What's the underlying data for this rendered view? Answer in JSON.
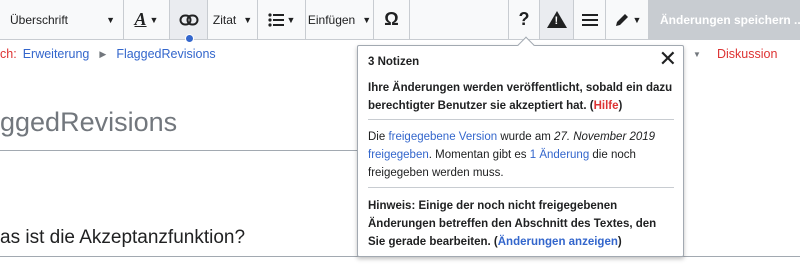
{
  "toolbar": {
    "format_label": "Überschrift",
    "quote_label": "Zitat",
    "insert_label": "Einfügen",
    "omega_glyph": "Ω",
    "help_glyph": "?",
    "warning_glyph": "!",
    "save_label": "Änderungen speichern ..."
  },
  "breadcrumb": {
    "prefix": "ch:",
    "items": [
      "Erweiterung",
      "FlaggedRevisions"
    ]
  },
  "page": {
    "title": "ggedRevisions",
    "section_heading": "as ist die Akzeptanzfunktion?"
  },
  "tabs": {
    "discussion": "Diskussion"
  },
  "popup": {
    "title": "3 Notizen",
    "close_glyph": "✕",
    "notice1": {
      "text": "Ihre Änderungen werden veröffentlicht, sobald ein dazu berechtigter Benutzer sie akzeptiert hat. (",
      "link": "Hilfe",
      "after": ")"
    },
    "notice2": {
      "t1": "Die ",
      "link1": "freigegebene Version",
      "t2": " wurde am ",
      "date": "27. November 2019",
      "t3": " ",
      "link2": "freigegeben",
      "t4": ". Momentan gibt es ",
      "link3": "1 Änderung",
      "t5": " die noch freigegeben werden muss."
    },
    "notice3": {
      "text": "Hinweis: Einige der noch nicht freigegebenen Änderungen betreffen den Abschnitt des Textes, den Sie gerade bearbeiten. (",
      "link": "Änderungen anzeigen",
      "after": ")"
    }
  },
  "colors": {
    "link_blue": "#3366cc",
    "link_red": "#dd3333",
    "toolbar_bg": "#f8f9fa",
    "save_disabled": "#c8ccd1"
  }
}
